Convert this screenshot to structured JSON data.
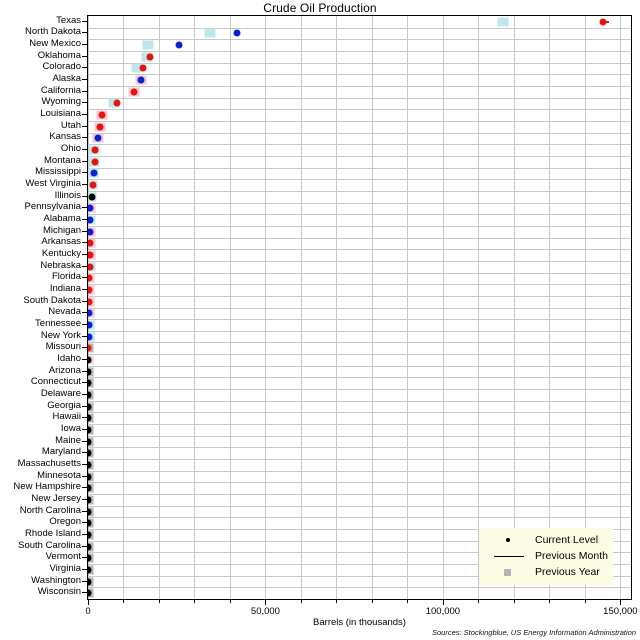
{
  "chart_data": {
    "type": "scatter",
    "title": "Crude Oil Production",
    "xlabel": "Barrels (in thousands)",
    "ylabel": "",
    "xlim": [
      0,
      153000
    ],
    "xticks": [
      0,
      50000,
      100000,
      150000
    ],
    "xticklabels": [
      "0",
      "50,000",
      "100,000",
      "150,000"
    ],
    "grid": true,
    "legend_position": "bottom-right",
    "legend": [
      {
        "key": "current-level",
        "label": "Current Level",
        "marker": "dot",
        "color": "#000000"
      },
      {
        "key": "previous-month",
        "label": "Previous Month",
        "marker": "line",
        "color": "#000000"
      },
      {
        "key": "previous-year",
        "label": "Previous Year",
        "marker": "square",
        "color": "#b4b4b4"
      }
    ],
    "series_note": "Dot color encodes change vs previous month (red = down, blue = up, black = flat); square color encodes change vs previous year (light blue = up, pink = down, gray = flat).",
    "categories": [
      "Texas",
      "North Dakota",
      "New Mexico",
      "Oklahoma",
      "Colorado",
      "Alaska",
      "California",
      "Wyoming",
      "Louisiana",
      "Utah",
      "Kansas",
      "Ohio",
      "Montana",
      "Mississippi",
      "West Virginia",
      "Illinois",
      "Pennsylvania",
      "Alabama",
      "Michigan",
      "Arkansas",
      "Kentucky",
      "Nebraska",
      "Florida",
      "Indiana",
      "South Dakota",
      "Nevada",
      "Tennessee",
      "New York",
      "Missouri",
      "Idaho",
      "Arizona",
      "Connecticut",
      "Delaware",
      "Georgia",
      "Hawaii",
      "Iowa",
      "Maine",
      "Maryland",
      "Massachusetts",
      "Minnesota",
      "New Hampshire",
      "New Jersey",
      "North Carolina",
      "Oregon",
      "Rhode Island",
      "South Carolina",
      "Vermont",
      "Virginia",
      "Washington",
      "Wisconsin"
    ],
    "points": [
      {
        "state": "Texas",
        "current": 145000,
        "prev_month": 146800,
        "prev_year": 117000,
        "dot_color": "#e8130c",
        "square_color": "#bfe6ea"
      },
      {
        "state": "North Dakota",
        "current": 42000,
        "prev_month": 42000,
        "prev_year": 34500,
        "dot_color": "#0b1fd6",
        "square_color": "#bfe6ea"
      },
      {
        "state": "New Mexico",
        "current": 25500,
        "prev_month": 25500,
        "prev_year": 17000,
        "dot_color": "#0b1fd6",
        "square_color": "#bfe6ea"
      },
      {
        "state": "Oklahoma",
        "current": 17500,
        "prev_month": 17500,
        "prev_year": 16500,
        "dot_color": "#e8130c",
        "square_color": "#bfe6ea"
      },
      {
        "state": "Colorado",
        "current": 15500,
        "prev_month": 15500,
        "prev_year": 13800,
        "dot_color": "#e8130c",
        "square_color": "#bfe6ea"
      },
      {
        "state": "Alaska",
        "current": 15000,
        "prev_month": 15000,
        "prev_year": 15000,
        "dot_color": "#0b1fd6",
        "square_color": "#f5c6d4"
      },
      {
        "state": "California",
        "current": 13000,
        "prev_month": 13000,
        "prev_year": 13000,
        "dot_color": "#e8130c",
        "square_color": "#f5c6d4"
      },
      {
        "state": "Wyoming",
        "current": 8200,
        "prev_month": 8200,
        "prev_year": 7200,
        "dot_color": "#e8130c",
        "square_color": "#bfe6ea"
      },
      {
        "state": "Louisiana",
        "current": 4000,
        "prev_month": 4000,
        "prev_year": 4000,
        "dot_color": "#e8130c",
        "square_color": "#f5c6d4"
      },
      {
        "state": "Utah",
        "current": 3300,
        "prev_month": 3300,
        "prev_year": 3300,
        "dot_color": "#e8130c",
        "square_color": "#f5c6d4"
      },
      {
        "state": "Kansas",
        "current": 2900,
        "prev_month": 2900,
        "prev_year": 2900,
        "dot_color": "#0b1fd6",
        "square_color": "#f5c6d4"
      },
      {
        "state": "Ohio",
        "current": 2000,
        "prev_month": 2000,
        "prev_year": 1600,
        "dot_color": "#e8130c",
        "square_color": "#bfe6ea"
      },
      {
        "state": "Montana",
        "current": 2000,
        "prev_month": 2000,
        "prev_year": 1600,
        "dot_color": "#e8130c",
        "square_color": "#bfe6ea"
      },
      {
        "state": "Mississippi",
        "current": 1700,
        "prev_month": 1700,
        "prev_year": 1300,
        "dot_color": "#0b1fd6",
        "square_color": "#bfe6ea"
      },
      {
        "state": "West Virginia",
        "current": 1500,
        "prev_month": 1500,
        "prev_year": 1000,
        "dot_color": "#e8130c",
        "square_color": "#bfe6ea"
      },
      {
        "state": "Illinois",
        "current": 1000,
        "prev_month": 1000,
        "prev_year": 900,
        "dot_color": "#000000",
        "square_color": "#bfe6ea"
      },
      {
        "state": "Pennsylvania",
        "current": 700,
        "prev_month": 700,
        "prev_year": 700,
        "dot_color": "#0b1fd6",
        "square_color": "#f5c6d4"
      },
      {
        "state": "Alabama",
        "current": 700,
        "prev_month": 700,
        "prev_year": 700,
        "dot_color": "#0b1fd6",
        "square_color": "#bfe6ea"
      },
      {
        "state": "Michigan",
        "current": 600,
        "prev_month": 600,
        "prev_year": 600,
        "dot_color": "#0b1fd6",
        "square_color": "#f5c6d4"
      },
      {
        "state": "Arkansas",
        "current": 600,
        "prev_month": 600,
        "prev_year": 600,
        "dot_color": "#e8130c",
        "square_color": "#f5c6d4"
      },
      {
        "state": "Kentucky",
        "current": 500,
        "prev_month": 500,
        "prev_year": 500,
        "dot_color": "#e8130c",
        "square_color": "#f5c6d4"
      },
      {
        "state": "Nebraska",
        "current": 500,
        "prev_month": 500,
        "prev_year": 500,
        "dot_color": "#e8130c",
        "square_color": "#bfe6ea"
      },
      {
        "state": "Florida",
        "current": 400,
        "prev_month": 400,
        "prev_year": 400,
        "dot_color": "#e8130c",
        "square_color": "#f5c6d4"
      },
      {
        "state": "Indiana",
        "current": 400,
        "prev_month": 400,
        "prev_year": 400,
        "dot_color": "#e8130c",
        "square_color": "#f5c6d4"
      },
      {
        "state": "South Dakota",
        "current": 300,
        "prev_month": 300,
        "prev_year": 300,
        "dot_color": "#e8130c",
        "square_color": "#f5c6d4"
      },
      {
        "state": "Nevada",
        "current": 250,
        "prev_month": 250,
        "prev_year": 250,
        "dot_color": "#0b1fd6",
        "square_color": "#f5c6d4"
      },
      {
        "state": "Tennessee",
        "current": 200,
        "prev_month": 200,
        "prev_year": 200,
        "dot_color": "#0b1fd6",
        "square_color": "#bfe6ea"
      },
      {
        "state": "New York",
        "current": 150,
        "prev_month": 150,
        "prev_year": 150,
        "dot_color": "#0b1fd6",
        "square_color": "#bfe6ea"
      },
      {
        "state": "Missouri",
        "current": 100,
        "prev_month": 100,
        "prev_year": 100,
        "dot_color": "#e8130c",
        "square_color": "#b4b4b4"
      },
      {
        "state": "Idaho",
        "current": 80,
        "prev_month": 80,
        "prev_year": 80,
        "dot_color": "#000000",
        "square_color": "#f5c6d4"
      },
      {
        "state": "Arizona",
        "current": 50,
        "prev_month": 50,
        "prev_year": 50,
        "dot_color": "#000000",
        "square_color": "#b4b4b4"
      },
      {
        "state": "Connecticut",
        "current": 0,
        "prev_month": 0,
        "prev_year": 0,
        "dot_color": "#000000",
        "square_color": "#b4b4b4"
      },
      {
        "state": "Delaware",
        "current": 0,
        "prev_month": 0,
        "prev_year": 0,
        "dot_color": "#000000",
        "square_color": "#b4b4b4"
      },
      {
        "state": "Georgia",
        "current": 0,
        "prev_month": 0,
        "prev_year": 0,
        "dot_color": "#000000",
        "square_color": "#b4b4b4"
      },
      {
        "state": "Hawaii",
        "current": 0,
        "prev_month": 0,
        "prev_year": 0,
        "dot_color": "#000000",
        "square_color": "#b4b4b4"
      },
      {
        "state": "Iowa",
        "current": 0,
        "prev_month": 0,
        "prev_year": 0,
        "dot_color": "#000000",
        "square_color": "#b4b4b4"
      },
      {
        "state": "Maine",
        "current": 0,
        "prev_month": 0,
        "prev_year": 0,
        "dot_color": "#000000",
        "square_color": "#b4b4b4"
      },
      {
        "state": "Maryland",
        "current": 0,
        "prev_month": 0,
        "prev_year": 0,
        "dot_color": "#000000",
        "square_color": "#b4b4b4"
      },
      {
        "state": "Massachusetts",
        "current": 0,
        "prev_month": 0,
        "prev_year": 0,
        "dot_color": "#000000",
        "square_color": "#b4b4b4"
      },
      {
        "state": "Minnesota",
        "current": 0,
        "prev_month": 0,
        "prev_year": 0,
        "dot_color": "#000000",
        "square_color": "#b4b4b4"
      },
      {
        "state": "New Hampshire",
        "current": 0,
        "prev_month": 0,
        "prev_year": 0,
        "dot_color": "#000000",
        "square_color": "#b4b4b4"
      },
      {
        "state": "New Jersey",
        "current": 0,
        "prev_month": 0,
        "prev_year": 0,
        "dot_color": "#000000",
        "square_color": "#b4b4b4"
      },
      {
        "state": "North Carolina",
        "current": 0,
        "prev_month": 0,
        "prev_year": 0,
        "dot_color": "#000000",
        "square_color": "#b4b4b4"
      },
      {
        "state": "Oregon",
        "current": 0,
        "prev_month": 0,
        "prev_year": 0,
        "dot_color": "#000000",
        "square_color": "#b4b4b4"
      },
      {
        "state": "Rhode Island",
        "current": 0,
        "prev_month": 0,
        "prev_year": 0,
        "dot_color": "#000000",
        "square_color": "#b4b4b4"
      },
      {
        "state": "South Carolina",
        "current": 0,
        "prev_month": 0,
        "prev_year": 0,
        "dot_color": "#000000",
        "square_color": "#b4b4b4"
      },
      {
        "state": "Vermont",
        "current": 0,
        "prev_month": 0,
        "prev_year": 0,
        "dot_color": "#000000",
        "square_color": "#b4b4b4"
      },
      {
        "state": "Virginia",
        "current": 0,
        "prev_month": 0,
        "prev_year": 0,
        "dot_color": "#000000",
        "square_color": "#b4b4b4"
      },
      {
        "state": "Washington",
        "current": 0,
        "prev_month": 0,
        "prev_year": 0,
        "dot_color": "#000000",
        "square_color": "#b4b4b4"
      },
      {
        "state": "Wisconsin",
        "current": 0,
        "prev_month": 0,
        "prev_year": 0,
        "dot_color": "#000000",
        "square_color": "#b4b4b4"
      }
    ]
  },
  "footer": {
    "source": "Sources: Stockingblue, US Energy Information Administration"
  }
}
